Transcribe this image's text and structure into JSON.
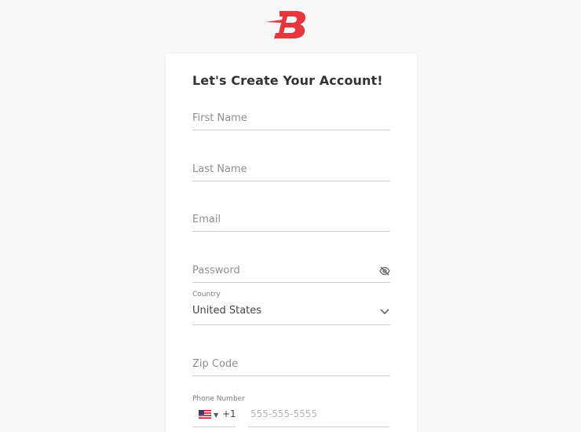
{
  "brand": {
    "logo_letter": "B",
    "accent_color": "#e8363f"
  },
  "form": {
    "title": "Let's Create Your Account!",
    "first_name": {
      "placeholder": "First Name"
    },
    "last_name": {
      "placeholder": "Last Name"
    },
    "email": {
      "placeholder": "Email"
    },
    "password": {
      "placeholder": "Password",
      "toggle_icon": "eye-slash-icon"
    },
    "country": {
      "label": "Country",
      "value": "United States",
      "icon": "chevron-down-icon"
    },
    "zip": {
      "placeholder": "Zip Code"
    },
    "phone": {
      "label": "Phone Number",
      "flag": "us-flag-icon",
      "dial_code": "+1",
      "placeholder": "555-555-5555"
    }
  }
}
